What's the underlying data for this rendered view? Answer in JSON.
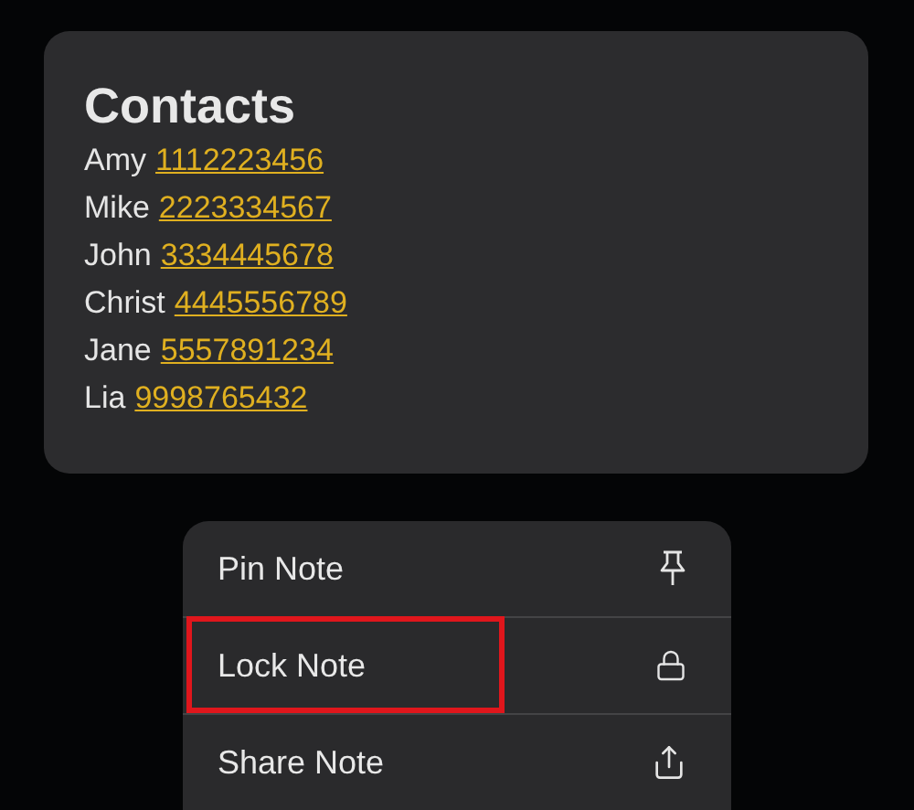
{
  "note": {
    "title": "Contacts",
    "contacts": [
      {
        "name": "Amy",
        "phone": "1112223456"
      },
      {
        "name": "Mike",
        "phone": "2223334567"
      },
      {
        "name": "John",
        "phone": "3334445678"
      },
      {
        "name": "Christ",
        "phone": "4445556789"
      },
      {
        "name": "Jane",
        "phone": "5557891234"
      },
      {
        "name": "Lia",
        "phone": "9998765432"
      }
    ]
  },
  "menu": {
    "items": [
      {
        "label": "Pin Note",
        "highlighted": false
      },
      {
        "label": "Lock Note",
        "highlighted": true
      },
      {
        "label": "Share Note",
        "highlighted": false
      }
    ]
  }
}
